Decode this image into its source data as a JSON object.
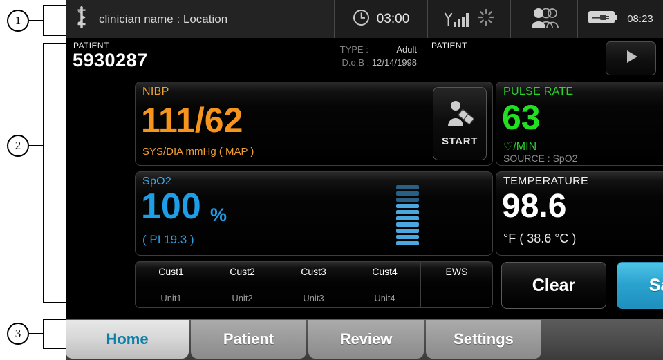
{
  "callouts": [
    {
      "number": "1"
    },
    {
      "number": "2"
    },
    {
      "number": "3"
    }
  ],
  "statusbar": {
    "caduceus_icon": "caduceus-icon",
    "clinician": "clinician name : Location",
    "timer": "03:00",
    "clock_icon": "clock-icon",
    "signal_icon": "wifi-signal-icon",
    "spinner_icon": "loading-spinner-icon",
    "patients_icon": "patient-group-icon",
    "battery_icon": "battery-charging-icon",
    "time": "08:23"
  },
  "patient_header": {
    "label": "PATIENT",
    "id": "5930287",
    "type_key": "TYPE :",
    "type_value": "Adult",
    "dob_key": "D.o.B :",
    "dob_value": "12/14/1998",
    "right_label": "PATIENT",
    "play_icon": "play-icon"
  },
  "vitals": {
    "nibp": {
      "title": "NIBP",
      "value": "111/62",
      "subtitle": "SYS/DIA mmHg ( MAP )",
      "start_label": "START",
      "start_icon": "bp-cuff-person-icon",
      "color": "#f7941d"
    },
    "pulse": {
      "title": "PULSE RATE",
      "value": "63",
      "unit": "♡/MIN",
      "source": "SOURCE : SpO2",
      "color": "#21e021"
    },
    "spo2": {
      "title": "SpO2",
      "value": "100",
      "percent": "%",
      "subtitle": "( PI 19.3 )",
      "color": "#1f9ee8",
      "bargraph_segments": 10,
      "bargraph_dim_segments": 3
    },
    "temperature": {
      "title": "TEMPERATURE",
      "value": "98.6",
      "subtitle": "°F  ( 38.6 °C )",
      "icon": "temporal-thermometer-person-icon",
      "color": "#ffffff"
    }
  },
  "custom_row": {
    "cells": [
      {
        "name": "Cust1",
        "unit": "Unit1"
      },
      {
        "name": "Cust2",
        "unit": "Unit2"
      },
      {
        "name": "Cust3",
        "unit": "Unit3"
      },
      {
        "name": "Cust4",
        "unit": "Unit4"
      }
    ],
    "ews_label": "EWS"
  },
  "actions": {
    "clear_label": "Clear",
    "save_label": "Save",
    "save_color": "#2aa3cf"
  },
  "tabs": [
    {
      "label": "Home",
      "active": true
    },
    {
      "label": "Patient",
      "active": false
    },
    {
      "label": "Review",
      "active": false
    },
    {
      "label": "Settings",
      "active": false
    }
  ]
}
